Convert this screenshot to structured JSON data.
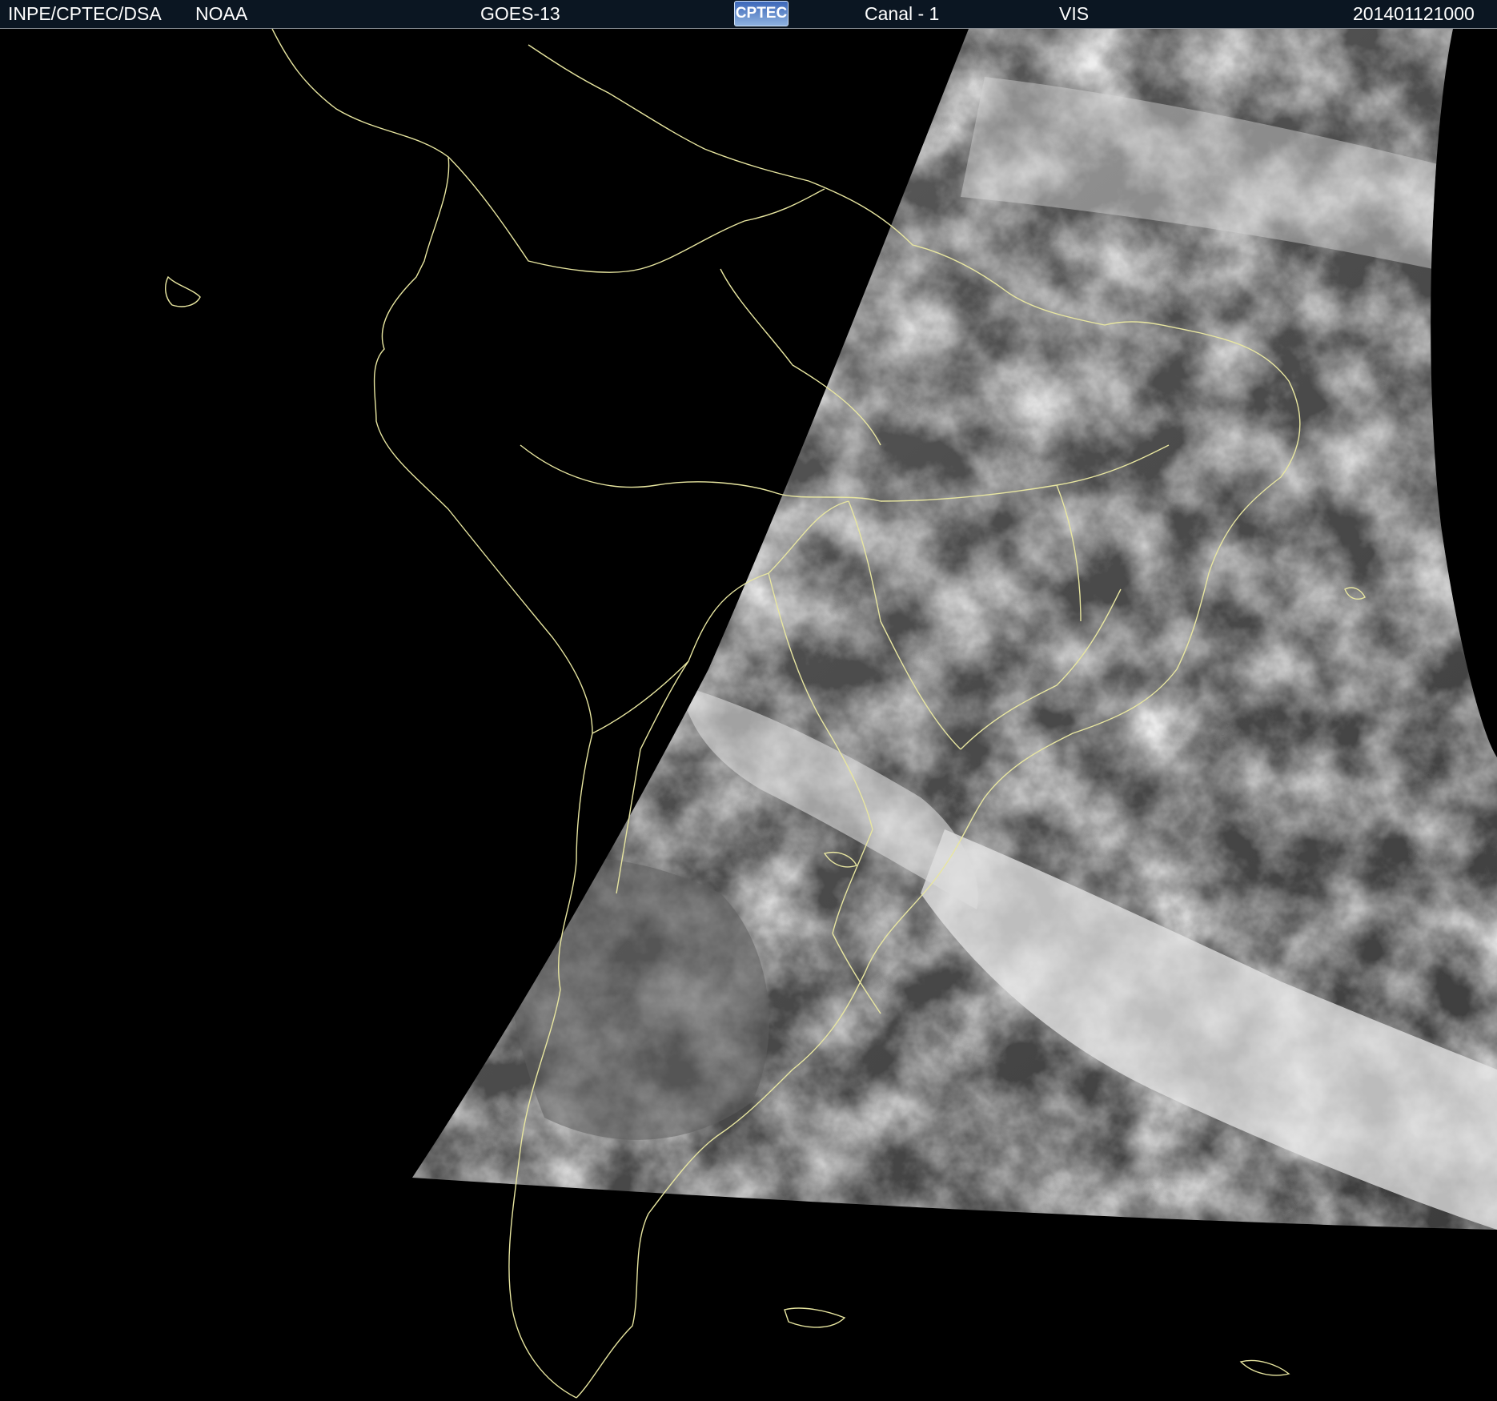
{
  "header": {
    "source": "INPE/CPTEC/DSA",
    "agency": "NOAA",
    "satellite": "GOES-13",
    "logo_text": "CPTEC",
    "channel": "Canal - 1",
    "band": "VIS",
    "timestamp": "201401121000"
  },
  "image": {
    "type": "satellite-visible-image",
    "subject": "South America cloud cover",
    "border_color": "#e8e6a0",
    "background_color": "#000000"
  }
}
